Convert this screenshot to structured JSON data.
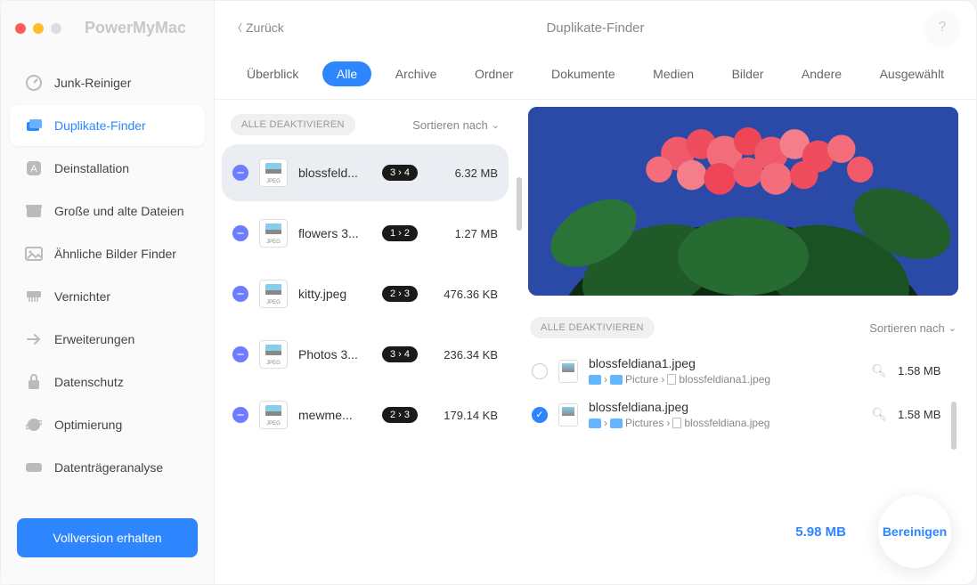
{
  "brand": "PowerMyMac",
  "back_label": "Zurück",
  "page_title": "Duplikate-Finder",
  "help_label": "?",
  "sidebar": {
    "items": [
      {
        "label": "Junk-Reiniger",
        "icon": "gauge-icon"
      },
      {
        "label": "Duplikate-Finder",
        "icon": "folder-stack-icon"
      },
      {
        "label": "Deinstallation",
        "icon": "app-icon"
      },
      {
        "label": "Große und alte Dateien",
        "icon": "archive-icon"
      },
      {
        "label": "Ähnliche Bilder Finder",
        "icon": "photo-icon"
      },
      {
        "label": "Vernichter",
        "icon": "shredder-icon"
      },
      {
        "label": "Erweiterungen",
        "icon": "arrow-right-icon"
      },
      {
        "label": "Datenschutz",
        "icon": "lock-icon"
      },
      {
        "label": "Optimierung",
        "icon": "sphere-icon"
      },
      {
        "label": "Datenträgeranalyse",
        "icon": "disk-icon"
      }
    ],
    "cta": "Vollversion erhalten"
  },
  "tabs": [
    "Überblick",
    "Alle",
    "Archive",
    "Ordner",
    "Dokumente",
    "Medien",
    "Bilder",
    "Andere",
    "Ausgewählt"
  ],
  "active_tab": 1,
  "deactivate_all": "ALLE DEAKTIVIEREN",
  "sort_label": "Sortieren nach",
  "groups": [
    {
      "name": "blossfeld...",
      "count": "3 › 4",
      "size": "6.32 MB"
    },
    {
      "name": "flowers 3...",
      "count": "1 › 2",
      "size": "1.27 MB"
    },
    {
      "name": "kitty.jpeg",
      "count": "2 › 3",
      "size": "476.36 KB"
    },
    {
      "name": "Photos 3...",
      "count": "3 › 4",
      "size": "236.34 KB"
    },
    {
      "name": "mewme...",
      "count": "2 › 3",
      "size": "179.14 KB"
    }
  ],
  "thumb_label": "JPEG",
  "files": [
    {
      "name": "blossfeldiana1.jpeg",
      "folder": "Picture",
      "filename": "blossfeldiana1.jpeg",
      "size": "1.58 MB",
      "checked": false
    },
    {
      "name": "blossfeldiana.jpeg",
      "folder": "Pictures",
      "filename": "blossfeldiana.jpeg",
      "size": "1.58 MB",
      "checked": true
    }
  ],
  "total_size": "5.98 MB",
  "clean_label": "Bereinigen",
  "colors": {
    "accent": "#2e86ff"
  }
}
